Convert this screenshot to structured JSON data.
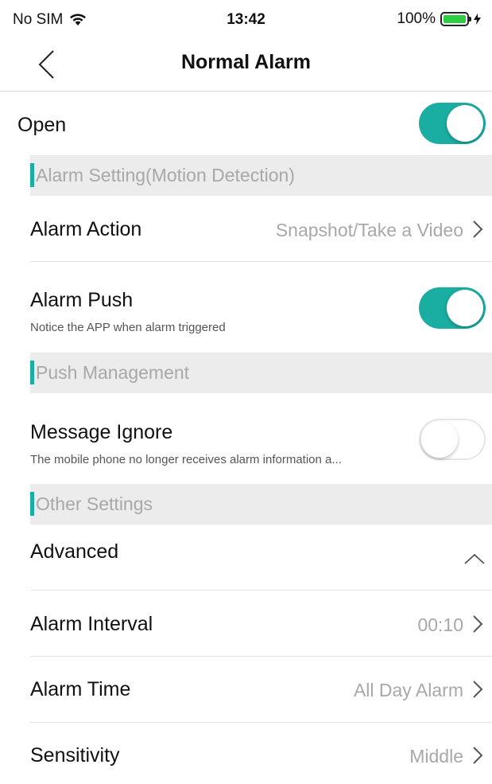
{
  "status_bar": {
    "carrier": "No SIM",
    "time": "13:42",
    "battery": "100%"
  },
  "nav": {
    "title": "Normal Alarm"
  },
  "open": {
    "label": "Open",
    "enabled": true
  },
  "sections": {
    "alarm_setting": "Alarm Setting(Motion Detection)",
    "push_management": "Push Management",
    "other_settings": "Other Settings"
  },
  "alarm_action": {
    "label": "Alarm Action",
    "value": "Snapshot/Take a Video"
  },
  "alarm_push": {
    "label": "Alarm Push",
    "sublabel": "Notice the APP when alarm triggered",
    "enabled": true
  },
  "message_ignore": {
    "label": "Message Ignore",
    "sublabel": "The mobile phone no longer receives alarm information a...",
    "enabled": false
  },
  "advanced": {
    "label": "Advanced"
  },
  "alarm_interval": {
    "label": "Alarm Interval",
    "value": "00:10"
  },
  "alarm_time": {
    "label": "Alarm Time",
    "value": "All Day Alarm"
  },
  "sensitivity": {
    "label": "Sensitivity",
    "value": "Middle"
  },
  "colors": {
    "accent": "#1aada1",
    "section_bg": "#ececec",
    "muted_text": "#a8a8a8"
  }
}
